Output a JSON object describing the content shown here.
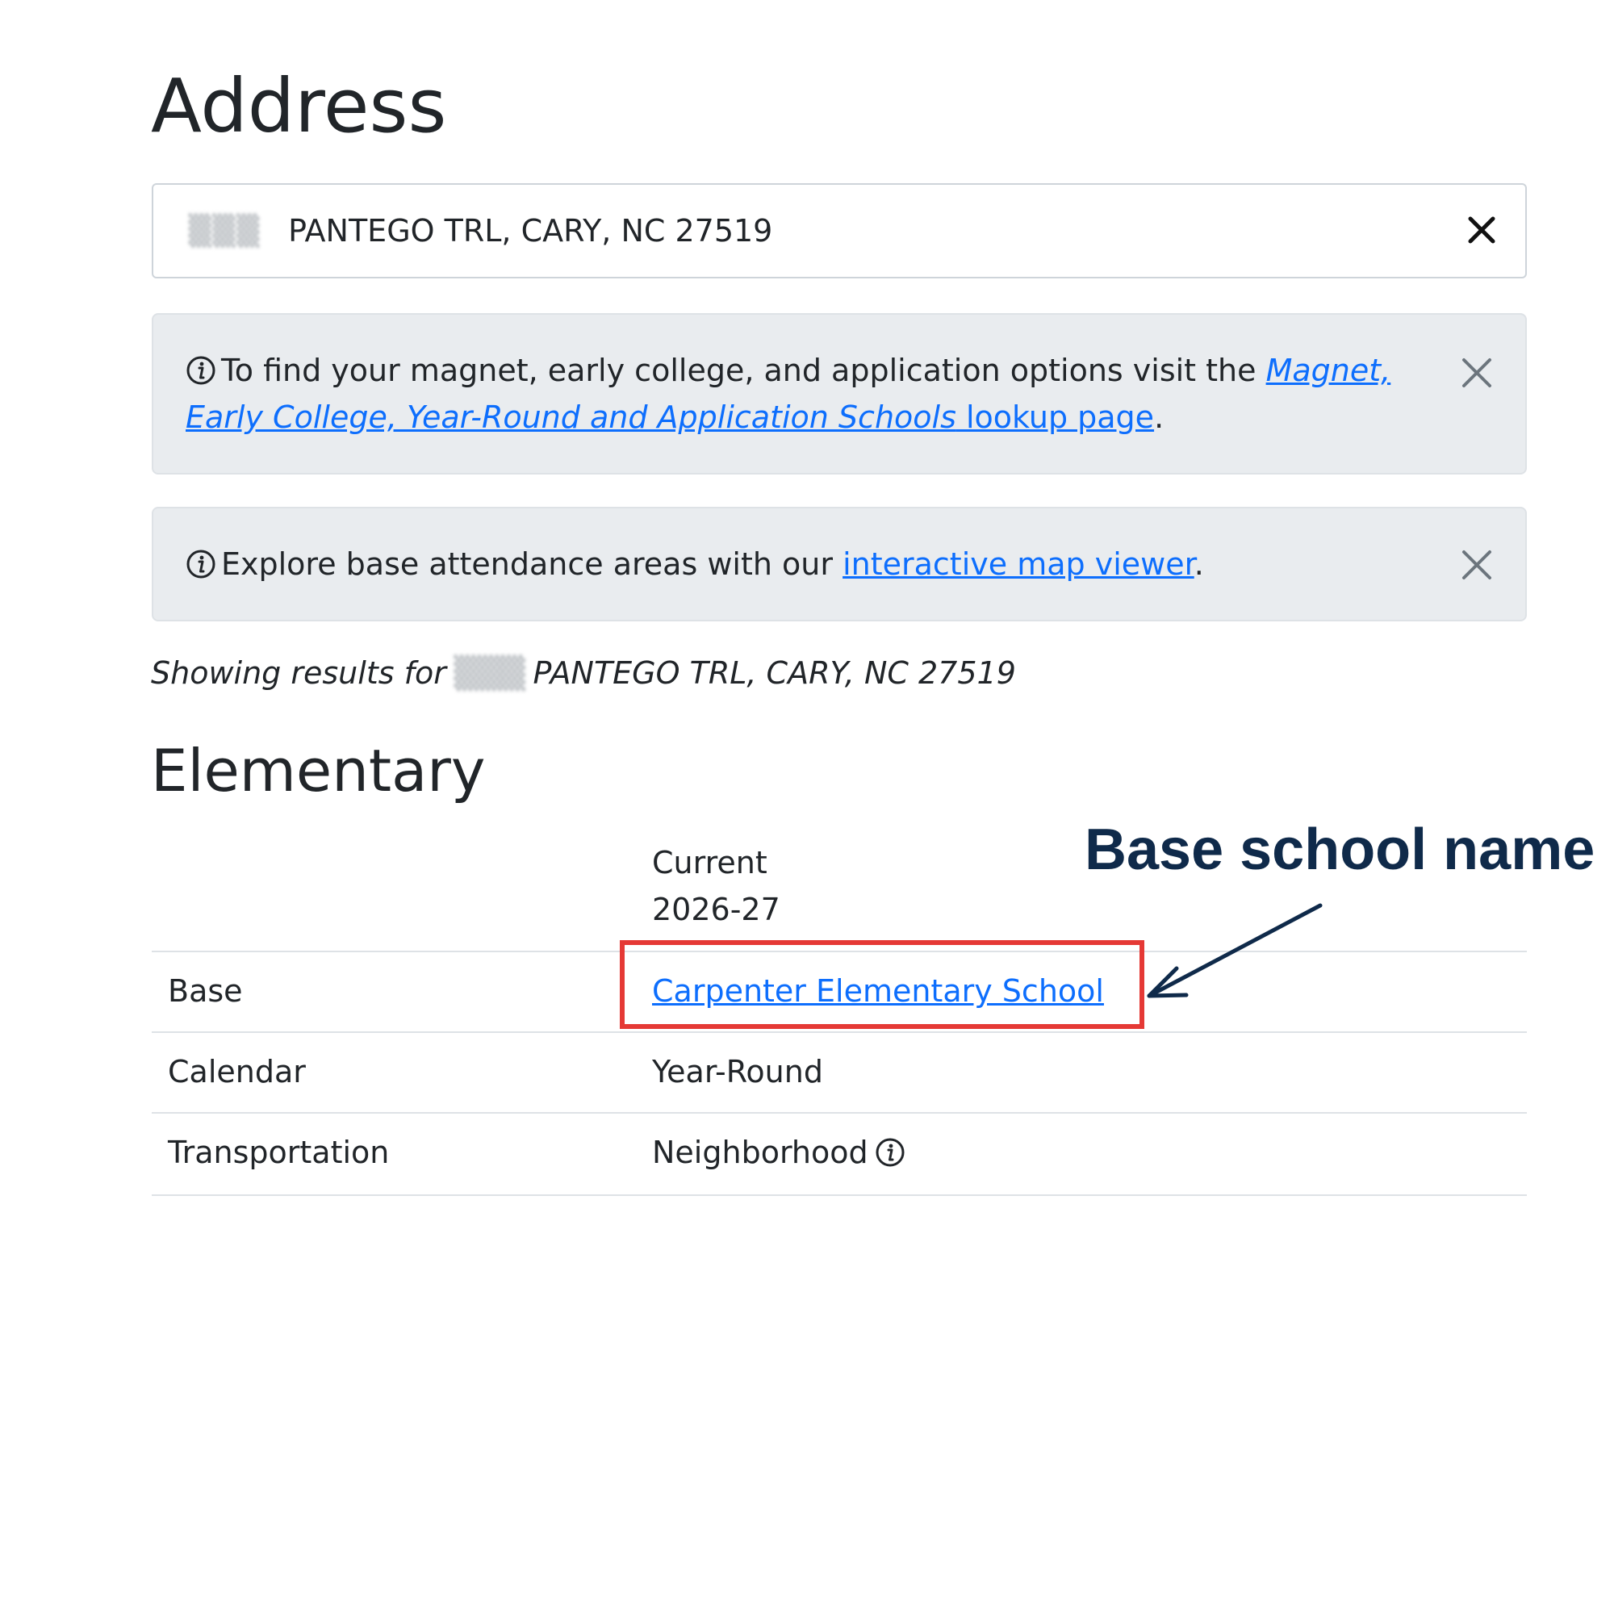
{
  "page": {
    "title": "Address",
    "address_input": {
      "value": "PANTEGO TRL, CARY, NC 27519"
    }
  },
  "alerts": [
    {
      "text_before": "To find your magnet, early college, and application options visit the ",
      "link_italic": "Magnet, Early College, Year-Round and Application Schools",
      "link_plain": " lookup page",
      "text_after": "."
    },
    {
      "text_before": "Explore base attendance areas with our ",
      "link": "interactive map viewer",
      "text_after": "."
    }
  ],
  "results": {
    "showing_prefix": "Showing results for",
    "showing_address": "PANTEGO TRL, CARY, NC 27519",
    "section_title": "Elementary",
    "column_header_line1": "Current",
    "column_header_line2": "2026-27",
    "rows": [
      {
        "label": "Base",
        "value": "Carpenter Elementary School"
      },
      {
        "label": "Calendar",
        "value": "Year-Round"
      },
      {
        "label": "Transportation",
        "value": "Neighborhood"
      }
    ]
  },
  "annotation": {
    "label": "Base school name",
    "highlight_color": "#e53935",
    "label_color": "#0f2a4a"
  },
  "colors": {
    "link": "#0d6efd",
    "alert_bg": "#e9ecef",
    "text": "#212529"
  },
  "icons": {
    "clear": "close-icon",
    "info": "info-circle-icon",
    "dismiss": "close-icon"
  }
}
